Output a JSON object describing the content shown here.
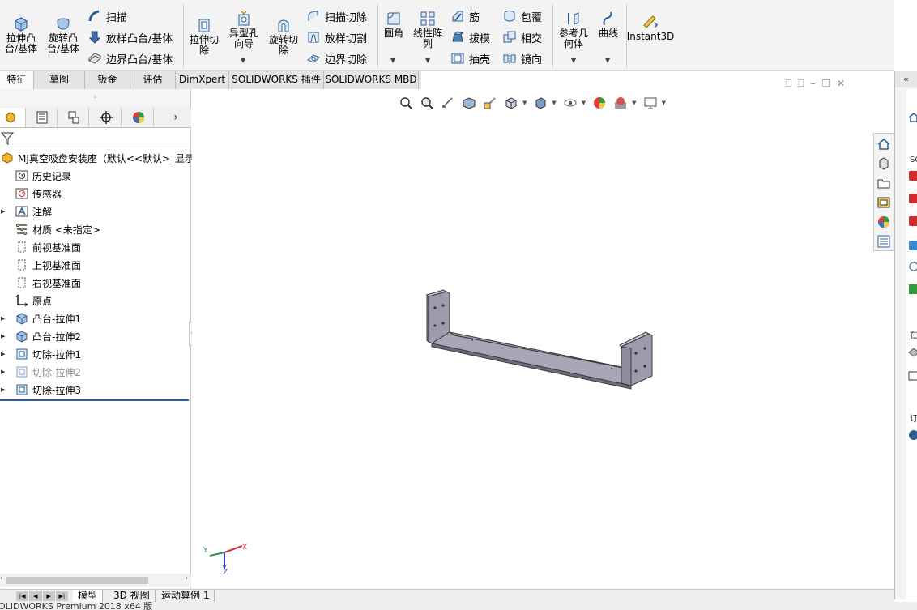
{
  "ribbon": {
    "extrude_boss": "拉伸凸\n台/基体",
    "revolve_boss": "旋转凸\n台/基体",
    "sweep": "扫描",
    "loft_boss": "放样凸台/基体",
    "boundary_boss": "边界凸台/基体",
    "extrude_cut": "拉伸切\n除",
    "hole_wizard": "异型孔\n向导",
    "revolve_cut": "旋转切\n除",
    "sweep_cut": "扫描切除",
    "loft_cut": "放样切割",
    "boundary_cut": "边界切除",
    "fillet": "圆角",
    "linear_pattern": "线性阵\n列",
    "rib": "筋",
    "draft": "拔模",
    "shell": "抽壳",
    "wrap": "包覆",
    "intersect": "相交",
    "mirror": "镜向",
    "reference_geometry": "参考几\n何体",
    "curves": "曲线",
    "instant3d": "Instant3D"
  },
  "tabs": [
    "特征",
    "草图",
    "钣金",
    "评估",
    "DimXpert",
    "SOLIDWORKS 插件",
    "SOLIDWORKS MBD"
  ],
  "tree": {
    "root": "MJ真空吸盘安装座（默认<<默认>_显示",
    "items": [
      {
        "label": "历史记录",
        "icon": "history-icon"
      },
      {
        "label": "传感器",
        "icon": "sensor-icon"
      },
      {
        "label": "注解",
        "icon": "annotation-icon"
      },
      {
        "label": "材质 <未指定>",
        "icon": "material-icon"
      },
      {
        "label": "前视基准面",
        "icon": "plane-icon"
      },
      {
        "label": "上视基准面",
        "icon": "plane-icon"
      },
      {
        "label": "右视基准面",
        "icon": "plane-icon"
      },
      {
        "label": "原点",
        "icon": "origin-icon"
      },
      {
        "label": "凸台-拉伸1",
        "icon": "boss-extrude-icon"
      },
      {
        "label": "凸台-拉伸2",
        "icon": "boss-extrude-icon"
      },
      {
        "label": "切除-拉伸1",
        "icon": "cut-extrude-icon"
      },
      {
        "label": "切除-拉伸2",
        "icon": "cut-extrude-icon"
      },
      {
        "label": "切除-拉伸3",
        "icon": "cut-extrude-icon"
      }
    ]
  },
  "triad": {
    "x": "X",
    "y": "Y",
    "z": "Z"
  },
  "bottom_tabs": [
    "模型",
    "3D 视图",
    "运动算例 1"
  ],
  "status": "OLIDWORKS Premium 2018 x64 版",
  "right_strip": {
    "head": "«",
    "labels": [
      "SO",
      "在",
      "订"
    ]
  },
  "colors": {
    "accent": "#2c5ea8",
    "part": "#9a9aaa",
    "ribbon_bg": "#f3f3f3"
  }
}
